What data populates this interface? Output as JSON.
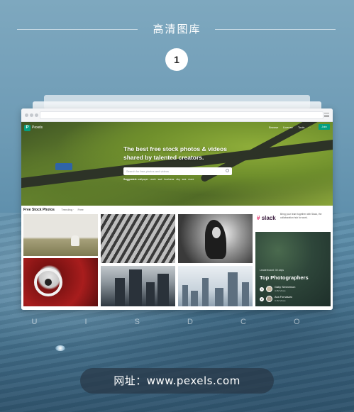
{
  "header": {
    "title": "高清图库",
    "step_number": "1"
  },
  "browser": {
    "site": {
      "logo_letter": "P",
      "name": "Pexels",
      "nav": [
        "Browse",
        "License",
        "Tools",
        "···"
      ],
      "join_label": "Join"
    },
    "hero": {
      "headline": "The best free stock photos & videos shared by talented creators.",
      "search_placeholder": "Search for free photos and videos",
      "suggested_label": "Suggested:",
      "suggested_terms": "wallpaper · work · sad · business · sky · sea · more"
    },
    "content": {
      "section_title": "Free Stock Photos",
      "sort_label": "Trending",
      "sort_option": "Free"
    },
    "ad": {
      "brand": "slack",
      "text": "Bring your team together with Slack, the collaboration hub for work."
    },
    "top_photographers": {
      "small_label": "Leaderboard: 30 days",
      "title": "Top Photographers",
      "entries": [
        {
          "rank": "1",
          "name": "Gaby Simmerson",
          "sub": "4.4M Views"
        },
        {
          "rank": "2",
          "name": "Ana Fornasaro",
          "sub": "3.1M Views"
        }
      ]
    }
  },
  "watermark": "U I S D C O",
  "footer": {
    "url_text": "网址：www.pexels.com"
  },
  "colors": {
    "accent": "#05a081",
    "background_top": "#7ea8bf",
    "pill": "#28374699"
  }
}
